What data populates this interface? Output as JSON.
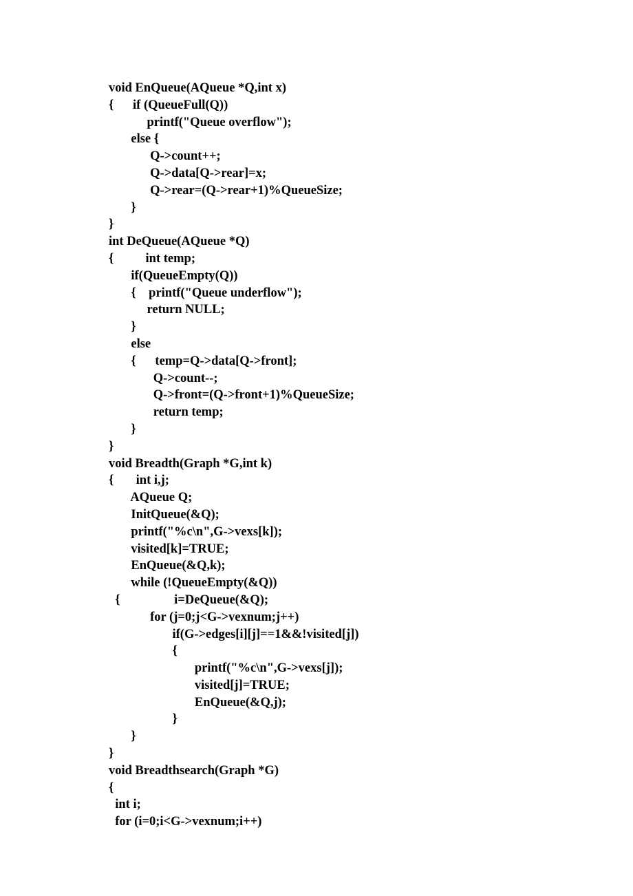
{
  "code": {
    "lines": [
      "void EnQueue(AQueue *Q,int x)",
      "{      if (QueueFull(Q))",
      "            printf(\"Queue overflow\");",
      "       else {",
      "             Q->count++;",
      "             Q->data[Q->rear]=x;",
      "             Q->rear=(Q->rear+1)%QueueSize;",
      "       }",
      "}",
      "int DeQueue(AQueue *Q)",
      "{          int temp;",
      "       if(QueueEmpty(Q))",
      "       {    printf(\"Queue underflow\");",
      "            return NULL;",
      "       }",
      "       else",
      "       {      temp=Q->data[Q->front];",
      "              Q->count--;",
      "              Q->front=(Q->front+1)%QueueSize;",
      "              return temp;",
      "       }",
      "}",
      "void Breadth(Graph *G,int k)",
      "{       int i,j;",
      "       AQueue Q;",
      "       InitQueue(&Q);",
      "       printf(\"%c\\n\",G->vexs[k]);",
      "       visited[k]=TRUE;",
      "       EnQueue(&Q,k);",
      "       while (!QueueEmpty(&Q))",
      "  {                 i=DeQueue(&Q);",
      "             for (j=0;j<G->vexnum;j++)",
      "                    if(G->edges[i][j]==1&&!visited[j])",
      "                    {",
      "                           printf(\"%c\\n\",G->vexs[j]);",
      "                           visited[j]=TRUE;",
      "                           EnQueue(&Q,j);",
      "                    }",
      "       }",
      "}",
      "void Breadthsearch(Graph *G)",
      "{",
      "  int i;",
      "  for (i=0;i<G->vexnum;i++)"
    ]
  }
}
